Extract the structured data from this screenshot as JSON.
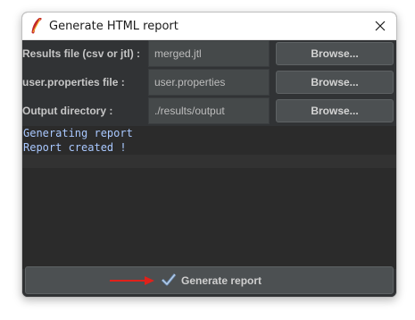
{
  "window": {
    "title": "Generate HTML report",
    "icon": "feather-icon",
    "close_icon": "close-icon"
  },
  "form": {
    "rows": [
      {
        "label": "Results file (csv or jtl) :",
        "value": "merged.jtl",
        "browse": "Browse..."
      },
      {
        "label": "user.properties file :",
        "value": "user.properties",
        "browse": "Browse..."
      },
      {
        "label": "Output directory :",
        "value": "./results/output",
        "browse": "Browse..."
      }
    ]
  },
  "console": {
    "lines": [
      "Generating report",
      "Report created !"
    ]
  },
  "action": {
    "label": "Generate report",
    "icon": "checkmark-icon",
    "annotation_icon": "red-arrow-icon"
  },
  "colors": {
    "background": "#313335",
    "console_text": "#a9c8ff",
    "arrow": "#e0211a"
  }
}
